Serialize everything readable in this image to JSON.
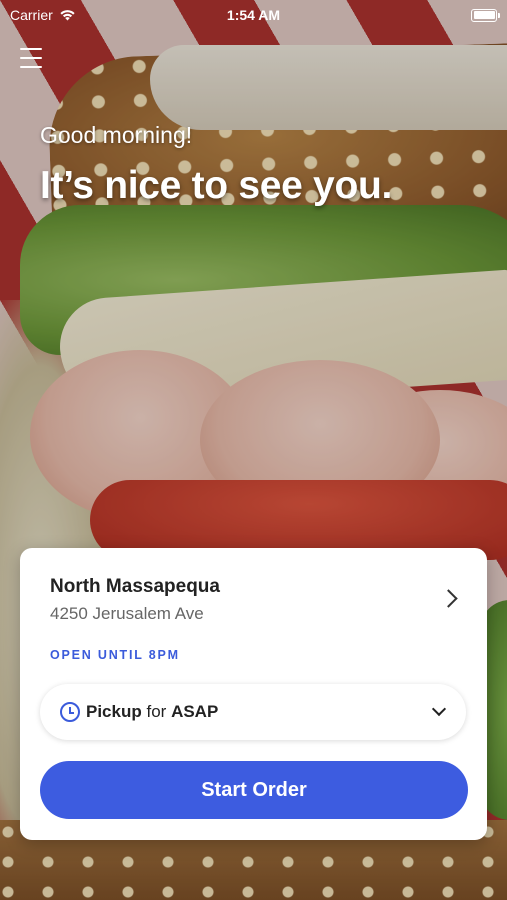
{
  "status_bar": {
    "carrier": "Carrier",
    "time": "1:54 AM",
    "wifi_icon": "wifi-icon",
    "battery_level": 1.0
  },
  "header": {
    "menu_icon": "hamburger-menu-icon",
    "greeting": "Good morning!",
    "headline": "It’s nice to see you."
  },
  "store_card": {
    "name": "North Massapequa",
    "address": "4250 Jerusalem Ave",
    "hours": "OPEN UNTIL 8PM",
    "hours_color": "#3b5bdb",
    "pickup": {
      "mode": "Pickup",
      "connector": "for",
      "time": "ASAP"
    },
    "start_button": "Start Order",
    "accent_color": "#3d5ce0"
  }
}
